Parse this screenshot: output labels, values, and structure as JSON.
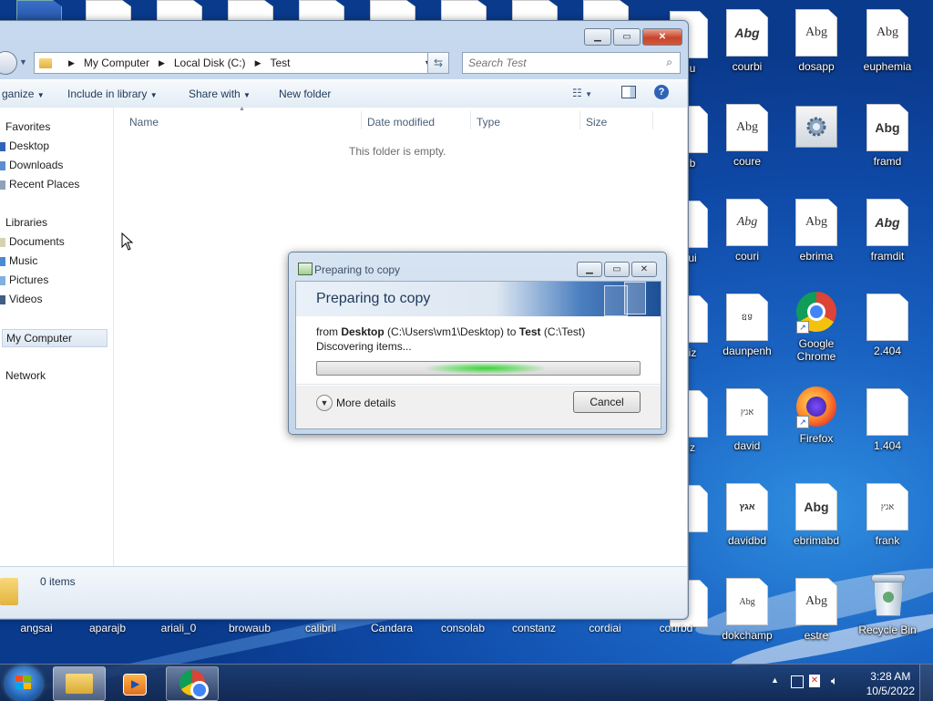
{
  "desktop": {
    "col1": [
      {
        "label": "courbi",
        "glyph": "Abg"
      },
      {
        "label": "coure",
        "glyph": "Abg"
      },
      {
        "label": "couri",
        "glyph": "Abg"
      },
      {
        "label": "daunpenh",
        "glyph": "ឧទ"
      },
      {
        "label": "david",
        "glyph": "אגץ"
      },
      {
        "label": "davidbd",
        "glyph": "אגץ"
      },
      {
        "label": "dokchamp",
        "glyph": "Abg"
      }
    ],
    "col2": [
      {
        "label": "dosapp",
        "glyph": "Abg"
      },
      {
        "label": "",
        "glyph": ""
      },
      {
        "label": "ebrima",
        "glyph": "Abg"
      },
      {
        "label": "Google Chrome",
        "glyph": ""
      },
      {
        "label": "Firefox",
        "glyph": ""
      },
      {
        "label": "ebrimabd",
        "glyph": "Abg"
      },
      {
        "label": "estre",
        "glyph": "Abg"
      }
    ],
    "col3": [
      {
        "label": "euphemia",
        "glyph": "Abg"
      },
      {
        "label": "framd",
        "glyph": "Abg"
      },
      {
        "label": "framdit",
        "glyph": "Abg"
      },
      {
        "label": "2.404",
        "glyph": ""
      },
      {
        "label": "1.404",
        "glyph": ""
      },
      {
        "label": "frank",
        "glyph": "אגץ"
      },
      {
        "label": "Recycle Bin",
        "glyph": ""
      }
    ],
    "bottom_row": [
      "angsai",
      "aparajb",
      "ariali_0",
      "browaub",
      "calibril",
      "Candara",
      "consolab",
      "constanz",
      "cordiai",
      "courbd"
    ],
    "partial_labels": [
      "u",
      "b",
      "ui",
      "iz",
      "z"
    ]
  },
  "explorer": {
    "breadcrumb": [
      "My Computer",
      "Local Disk (C:)",
      "Test"
    ],
    "search_placeholder": "Search Test",
    "toolbar": {
      "organize": "ganize",
      "include_in_library": "Include in library",
      "share_with": "Share with",
      "new_folder": "New folder"
    },
    "nav": {
      "favorites": "Favorites",
      "desktop": "Desktop",
      "downloads": "Downloads",
      "recent_places": "Recent Places",
      "libraries": "Libraries",
      "documents": "Documents",
      "music": "Music",
      "pictures": "Pictures",
      "videos": "Videos",
      "my_computer": "My Computer",
      "network": "Network"
    },
    "columns": [
      "Name",
      "Date modified",
      "Type",
      "Size"
    ],
    "empty_message": "This folder is empty.",
    "item_count": "0 items"
  },
  "dialog": {
    "caption": "Preparing to copy",
    "heading": "Preparing to copy",
    "from_prefix": "from",
    "source_name": "Desktop",
    "source_path": "(C:\\Users\\vm1\\Desktop)",
    "to_word": "to",
    "dest_name": "Test",
    "dest_path": "(C:\\Test)",
    "status": "Discovering items...",
    "more_details": "More details",
    "cancel": "Cancel"
  },
  "taskbar": {
    "time": "3:28 AM",
    "date": "10/5/2022"
  }
}
